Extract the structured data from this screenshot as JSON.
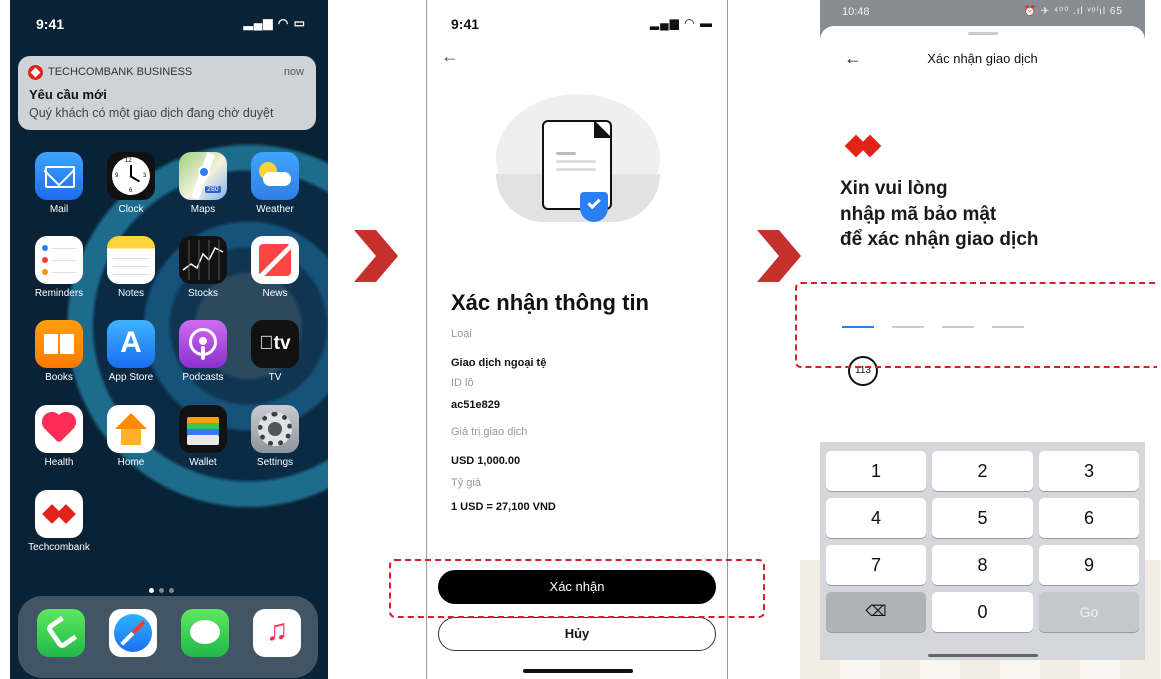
{
  "phone1": {
    "status": {
      "time": "9:41"
    },
    "notification": {
      "app": "TECHCOMBANK BUSINESS",
      "time": "now",
      "title": "Yêu cầu mới",
      "body": "Quý khách có một giao dịch đang chờ duyệt"
    },
    "apps": [
      {
        "label": "Mail",
        "icon": "mail-icon"
      },
      {
        "label": "Clock",
        "icon": "clock-icon"
      },
      {
        "label": "Maps",
        "icon": "maps-icon"
      },
      {
        "label": "Weather",
        "icon": "weather-icon"
      },
      {
        "label": "Reminders",
        "icon": "reminders-icon"
      },
      {
        "label": "Notes",
        "icon": "notes-icon"
      },
      {
        "label": "Stocks",
        "icon": "stocks-icon"
      },
      {
        "label": "News",
        "icon": "news-icon"
      },
      {
        "label": "Books",
        "icon": "books-icon"
      },
      {
        "label": "App Store",
        "icon": "app-store-icon"
      },
      {
        "label": "Podcasts",
        "icon": "podcasts-icon"
      },
      {
        "label": "TV",
        "icon": "tv-icon",
        "glyph": "tv"
      },
      {
        "label": "Health",
        "icon": "health-icon"
      },
      {
        "label": "Home",
        "icon": "home-icon"
      },
      {
        "label": "Wallet",
        "icon": "wallet-icon"
      },
      {
        "label": "Settings",
        "icon": "settings-icon"
      },
      {
        "label": "Techcombank",
        "icon": "techcombank-icon"
      }
    ],
    "dock": [
      "phone-icon",
      "safari-icon",
      "messages-icon",
      "music-icon"
    ],
    "map_badge": "280",
    "clock_numbers": [
      "12",
      "3",
      "6",
      "9"
    ]
  },
  "phone2": {
    "status": {
      "time": "9:41"
    },
    "heading": "Xác nhận thông tin",
    "fields": [
      {
        "label": "Loại",
        "value": "Giao dịch ngoại tệ"
      },
      {
        "label": "ID lô",
        "value": "ac51e829"
      },
      {
        "label": "Giá trị giao dịch",
        "value": "USD 1,000.00"
      },
      {
        "label": "Tỷ giá",
        "value": "1 USD = 27,100 VND"
      }
    ],
    "confirm_label": "Xác nhận",
    "cancel_label": "Hủy"
  },
  "phone3": {
    "status": {
      "time": "10:48",
      "right": "⏰ ✈ ⁴⁰⁰ .ıl ᵛᵒˡıl 65"
    },
    "title": "Xác nhận giao dịch",
    "prompt_lines": [
      "Xin vui lòng",
      "nhập mã bảo mật",
      "để xác nhận giao dịch"
    ],
    "otp_length": 4,
    "timer": "113",
    "keys": [
      "1",
      "2",
      "3",
      "4",
      "5",
      "6",
      "7",
      "8",
      "9",
      "⌫",
      "0",
      "Go"
    ]
  },
  "colors": {
    "brand_red": "#e2231a",
    "highlight_dash": "#d42026",
    "accent_blue": "#2a7ff3"
  }
}
